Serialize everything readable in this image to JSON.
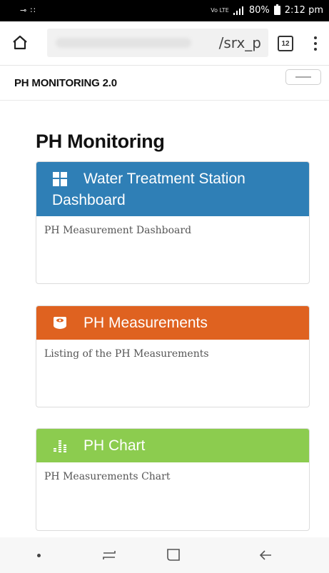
{
  "status_bar": {
    "left_icons": "⊸ ∷",
    "network": "Vo LTE",
    "battery": "80%",
    "time": "2:12 pm"
  },
  "browser": {
    "url_visible": "/srx_p",
    "tab_count": "12"
  },
  "navbar": {
    "brand": "PH MONITORING 2.0"
  },
  "page": {
    "title": "PH Monitoring"
  },
  "cards": [
    {
      "title_line1": "Water Treatment Station",
      "title_line2": "Dashboard",
      "icon": "dashboard-grid-icon",
      "body": "PH Measurement Dashboard",
      "color": "#2f7fb6"
    },
    {
      "title": "PH Measurements",
      "icon": "monitor-icon",
      "body": "Listing of the PH Measurements",
      "color": "#df6220"
    },
    {
      "title": "PH Chart",
      "icon": "bar-chart-icon",
      "body": "PH Measurements Chart",
      "color": "#8ccc4f"
    }
  ]
}
